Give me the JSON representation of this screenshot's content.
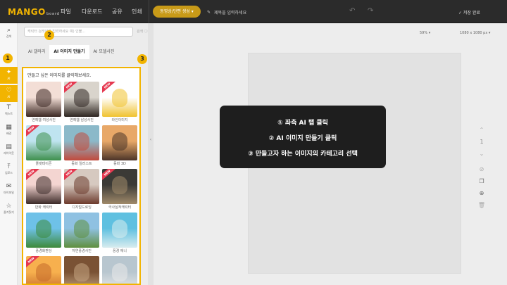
{
  "header": {
    "logo": "MANGO",
    "logo_small": "board",
    "menus": [
      "파일",
      "다운로드",
      "공유",
      "인쇄"
    ],
    "invite_button": "동영상/단편 생성 ▾",
    "title_placeholder": "제목을 입력하세요",
    "saved": "✓ 저장 완료"
  },
  "sidebar": {
    "items": [
      {
        "icon": "⌕",
        "label": "검색",
        "active": false
      },
      {
        "icon": "✦",
        "label": "AI",
        "active": true
      },
      {
        "icon": "♡",
        "label": "AI",
        "active": true
      },
      {
        "icon": "T",
        "label": "텍스트",
        "active": false
      },
      {
        "icon": "▦",
        "label": "배경",
        "active": false
      },
      {
        "icon": "▤",
        "label": "레이아웃",
        "active": false
      },
      {
        "icon": "⤒",
        "label": "업로드",
        "active": false
      },
      {
        "icon": "✉",
        "label": "마이파일",
        "active": false
      },
      {
        "icon": "☆",
        "label": "즐겨찾기",
        "active": false
      }
    ]
  },
  "panel": {
    "search_placeholder": "캐릭터 검색어를 입력하세요 예) 인물...",
    "search_button": "검색 ⓘ",
    "tabs": [
      "AI 갤러리",
      "AI 이미지 만들기",
      "AI 모델사진"
    ],
    "gallery_title": "만들고 싶은 이미지를 클릭해보세요.",
    "cards": [
      {
        "label": "연예웹 여성사진",
        "new": false,
        "c1": "#f3ded6",
        "c2": "#3a2722"
      },
      {
        "label": "연예웹 남성사진",
        "new": true,
        "c1": "#d9d4cc",
        "c2": "#2d2520"
      },
      {
        "label": "라인이미지",
        "new": true,
        "c1": "#ffffff",
        "c2": "#f0c22f"
      },
      {
        "label": "플랫테이즌",
        "new": true,
        "c1": "#bfe4f0",
        "c2": "#3e8f4c"
      },
      {
        "label": "동화 일러스트",
        "new": false,
        "c1": "#8bb9c9",
        "c2": "#c24a3c"
      },
      {
        "label": "동화 3D",
        "new": false,
        "c1": "#e8a868",
        "c2": "#4b3428"
      },
      {
        "label": "만화 캐릭터",
        "new": true,
        "c1": "#f4d5d1",
        "c2": "#3b2a28"
      },
      {
        "label": "디지털드로잉",
        "new": true,
        "c1": "#d6c9c0",
        "c2": "#6c3a2c"
      },
      {
        "label": "극사실적캐릭터",
        "new": true,
        "c1": "#3b3a36",
        "c2": "#a08a6a"
      },
      {
        "label": "풍경화판당",
        "new": false,
        "c1": "#6ec1e8",
        "c2": "#3d8a3a"
      },
      {
        "label": "자연풍경사진",
        "new": false,
        "c1": "#8fc1e2",
        "c2": "#5f8f3e"
      },
      {
        "label": "풍경 애니",
        "new": false,
        "c1": "#5fc0e0",
        "c2": "#d8ecef"
      },
      {
        "label": "",
        "new": true,
        "c1": "#f7b04e",
        "c2": "#c56a2a"
      },
      {
        "label": "",
        "new": false,
        "c1": "#7a5234",
        "c2": "#c4a482"
      },
      {
        "label": "",
        "new": false,
        "c1": "#b8c6cf",
        "c2": "#eaeaea"
      }
    ]
  },
  "markers": [
    "1",
    "2",
    "3"
  ],
  "canvas": {
    "zoom": "59% ▾",
    "size": "1080 x 1080 px ▾",
    "page_number": "1"
  },
  "tooltip": {
    "line1": "① 좌측 AI 탭 클릭",
    "line2": "② AI 이미지 만들기 클릭",
    "line3": "③ 만들고자 하는 이미지의 카테고리 선택"
  }
}
